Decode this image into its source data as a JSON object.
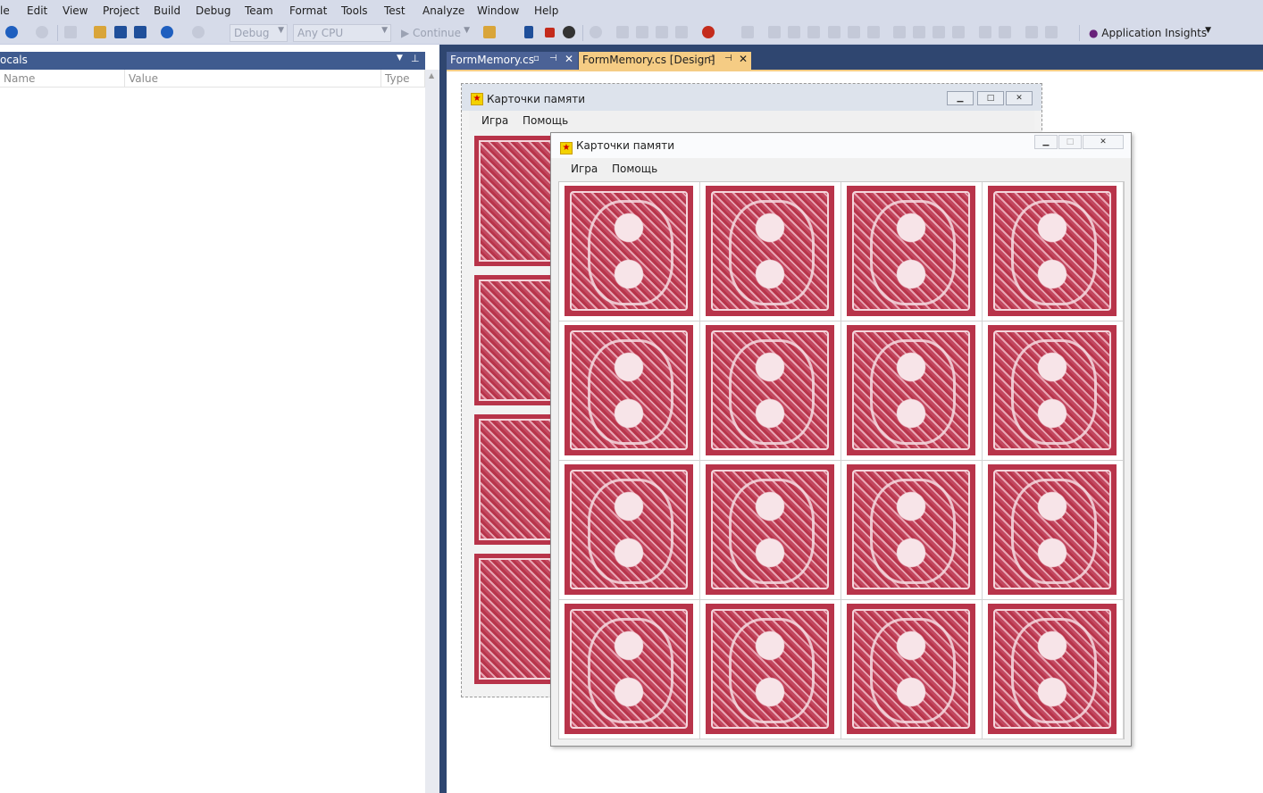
{
  "menubar": {
    "items": [
      "le",
      "Edit",
      "View",
      "Project",
      "Build",
      "Debug",
      "Team",
      "Format",
      "Tools",
      "Test",
      "Analyze",
      "Window",
      "Help"
    ]
  },
  "toolbar": {
    "config": "Debug",
    "platform": "Any CPU",
    "continue_label": "Continue",
    "insights_label": "Application Insights"
  },
  "locals": {
    "title": "ocals",
    "col_name": "Name",
    "col_value": "Value",
    "col_type": "Type"
  },
  "tabs": [
    {
      "label": "FormMemory.cs"
    },
    {
      "label": "FormMemory.cs [Design]"
    }
  ],
  "bg_form": {
    "title": "Карточки памяти",
    "menu": [
      "Игра",
      "Помощь"
    ]
  },
  "fg_form": {
    "title": "Карточки памяти",
    "menu": [
      "Игра",
      "Помощь"
    ],
    "grid_rows": 4,
    "grid_cols": 4
  },
  "colors": {
    "vs_chrome": "#d6dbe9",
    "vs_dark": "#2f4670",
    "active_tab": "#f5cc84",
    "card_red": "#b8344a"
  }
}
